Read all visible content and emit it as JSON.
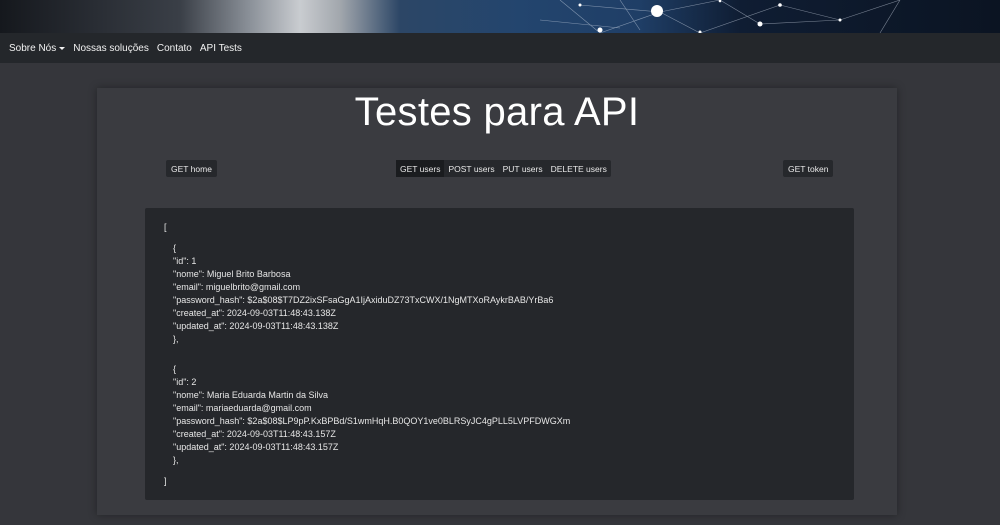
{
  "nav": {
    "items": [
      {
        "label": "Sobre Nós",
        "dropdown": true
      },
      {
        "label": "Nossas soluções"
      },
      {
        "label": "Contato"
      },
      {
        "label": "API Tests"
      }
    ]
  },
  "page": {
    "title": "Testes para API"
  },
  "buttons": {
    "get_home": "GET home",
    "get_token": "GET token",
    "group": [
      {
        "label": "GET users",
        "active": true
      },
      {
        "label": "POST users"
      },
      {
        "label": "PUT users"
      },
      {
        "label": "DELETE users"
      }
    ]
  },
  "response": {
    "open_bracket": "[",
    "close_bracket": "]",
    "users": [
      {
        "open": "{",
        "id": "\"id\": 1",
        "nome": "\"nome\": Miguel Brito Barbosa",
        "email": "\"email\": miguelbrito@gmail.com",
        "password_hash": "\"password_hash\": $2a$08$T7DZ2ixSFsaGgA1IjAxiduDZ73TxCWX/1NgMTXoRAykrBAB/YrBa6",
        "created_at": "\"created_at\": 2024-09-03T11:48:43.138Z",
        "updated_at": "\"updated_at\": 2024-09-03T11:48:43.138Z",
        "close": "},"
      },
      {
        "open": "{",
        "id": "\"id\": 2",
        "nome": "\"nome\": Maria Eduarda Martin da Silva",
        "email": "\"email\": mariaeduarda@gmail.com",
        "password_hash": "\"password_hash\": $2a$08$LP9pP.KxBPBd/S1wmHqH.B0QOY1ve0BLRSyJC4gPLL5LVPFDWGXm",
        "created_at": "\"created_at\": 2024-09-03T11:48:43.157Z",
        "updated_at": "\"updated_at\": 2024-09-03T11:48:43.157Z",
        "close": "},"
      }
    ]
  },
  "colors": {
    "background": "#35363b",
    "navbar": "#24272b",
    "panel": "#3a3b40",
    "code_bg": "#25272b",
    "button_bg": "#26282c"
  }
}
